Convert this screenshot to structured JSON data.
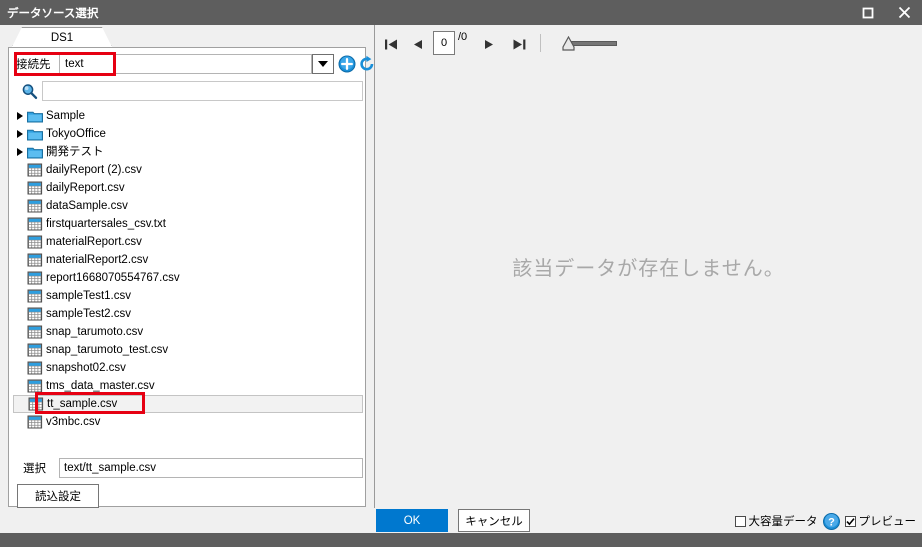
{
  "window": {
    "title": "データソース選択",
    "maximize_label": "maximize",
    "close_label": "close"
  },
  "tab": {
    "label": "DS1"
  },
  "connection": {
    "label": "接続先",
    "value": "text",
    "input_value": "",
    "dropdown_icon": "chevron-down-icon",
    "add_icon": "add-circle-icon",
    "refresh_icon": "refresh-icon"
  },
  "search": {
    "icon": "search-icon",
    "value": "",
    "placeholder": ""
  },
  "filelist": [
    {
      "name": "Sample",
      "type": "folder",
      "expandable": true,
      "selected": false
    },
    {
      "name": "TokyoOffice",
      "type": "folder",
      "expandable": true,
      "selected": false
    },
    {
      "name": "開発テスト",
      "type": "folder",
      "expandable": true,
      "selected": false
    },
    {
      "name": "dailyReport (2).csv",
      "type": "file",
      "expandable": false,
      "selected": false
    },
    {
      "name": "dailyReport.csv",
      "type": "file",
      "expandable": false,
      "selected": false
    },
    {
      "name": "dataSample.csv",
      "type": "file",
      "expandable": false,
      "selected": false
    },
    {
      "name": "firstquartersales_csv.txt",
      "type": "file",
      "expandable": false,
      "selected": false
    },
    {
      "name": "materialReport.csv",
      "type": "file",
      "expandable": false,
      "selected": false
    },
    {
      "name": "materialReport2.csv",
      "type": "file",
      "expandable": false,
      "selected": false
    },
    {
      "name": "report1668070554767.csv",
      "type": "file",
      "expandable": false,
      "selected": false
    },
    {
      "name": "sampleTest1.csv",
      "type": "file",
      "expandable": false,
      "selected": false
    },
    {
      "name": "sampleTest2.csv",
      "type": "file",
      "expandable": false,
      "selected": false
    },
    {
      "name": "snap_tarumoto.csv",
      "type": "file",
      "expandable": false,
      "selected": false
    },
    {
      "name": "snap_tarumoto_test.csv",
      "type": "file",
      "expandable": false,
      "selected": false
    },
    {
      "name": "snapshot02.csv",
      "type": "file",
      "expandable": false,
      "selected": false
    },
    {
      "name": "tms_data_master.csv",
      "type": "file",
      "expandable": false,
      "selected": false
    },
    {
      "name": "tt_sample.csv",
      "type": "file",
      "expandable": false,
      "selected": true
    },
    {
      "name": "v3mbc.csv",
      "type": "file",
      "expandable": false,
      "selected": false
    }
  ],
  "selection": {
    "label": "選択",
    "value": "text/tt_sample.csv"
  },
  "load_settings_button": {
    "label": "読込設定"
  },
  "pager": {
    "first_icon": "first-page-icon",
    "prev_icon": "previous-page-icon",
    "current_page": "0",
    "total_pages": "/0",
    "next_icon": "next-page-icon",
    "last_icon": "last-page-icon",
    "zoom_slider": "zoom-slider"
  },
  "preview": {
    "empty_message": "該当データが存在しません。"
  },
  "footer": {
    "ok_label": "OK",
    "cancel_label": "キャンセル",
    "large_data_label": "大容量データ",
    "large_data_checked": false,
    "help_icon": "help-icon",
    "preview_label": "プレビュー",
    "preview_checked": true
  },
  "annotations": {
    "highlight_color": "#e60012"
  }
}
